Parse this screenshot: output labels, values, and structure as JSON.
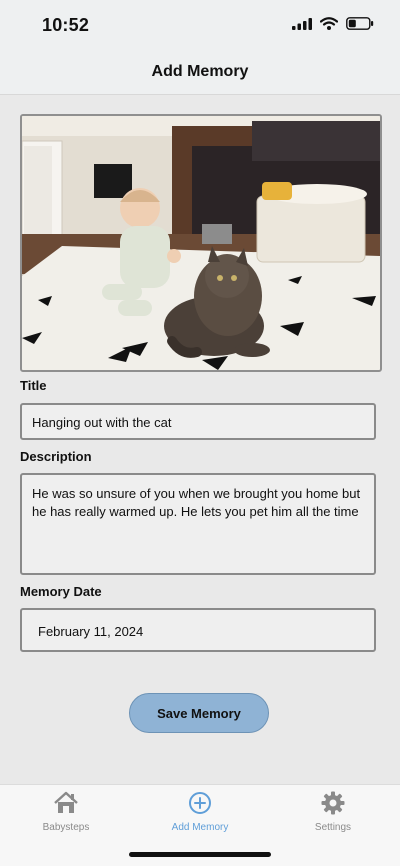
{
  "status_bar": {
    "time": "10:52"
  },
  "header": {
    "title": "Add Memory"
  },
  "photo": {
    "alt": "baby-with-cat-photo"
  },
  "form": {
    "title_label": "Title",
    "title_value": "Hanging out with the cat",
    "description_label": "Description",
    "description_value": "He was so unsure of you when we brought you home but he has really warmed up. He lets you pet him all the time",
    "date_label": "Memory Date",
    "date_value": "February 11, 2024"
  },
  "save_button": {
    "label": "Save Memory"
  },
  "tabs": [
    {
      "label": "Babysteps",
      "icon": "home-icon",
      "active": false
    },
    {
      "label": "Add Memory",
      "icon": "plus-circle-icon",
      "active": true
    },
    {
      "label": "Settings",
      "icon": "gear-icon",
      "active": false
    }
  ],
  "colors": {
    "accent": "#5f9ed8",
    "button": "#8fb3d5",
    "background": "#e9e9e9"
  }
}
